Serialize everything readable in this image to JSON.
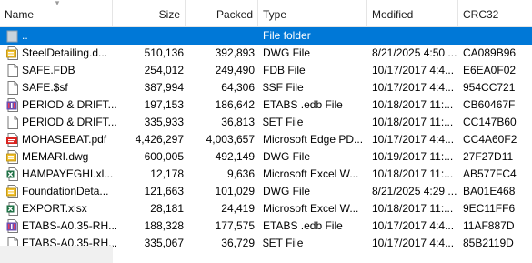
{
  "columns": {
    "name": "Name",
    "size": "Size",
    "packed": "Packed",
    "type": "Type",
    "modified": "Modified",
    "crc": "CRC32"
  },
  "sort_indicator": "▾",
  "rows": [
    {
      "name": "..",
      "size": "",
      "packed": "",
      "type": "File folder",
      "modified": "",
      "crc": "",
      "icon": "parent-folder-icon",
      "selected": true
    },
    {
      "name": "SteelDetailing.d...",
      "size": "510,136",
      "packed": "392,893",
      "type": "DWG File",
      "modified": "8/21/2025 4:50 ...",
      "crc": "CA089B96",
      "icon": "dwg-file-icon"
    },
    {
      "name": "SAFE.FDB",
      "size": "254,012",
      "packed": "249,490",
      "type": "FDB File",
      "modified": "10/17/2017 4:4...",
      "crc": "E6EA0F02",
      "icon": "generic-file-icon"
    },
    {
      "name": "SAFE.$sf",
      "size": "387,994",
      "packed": "64,306",
      "type": "$SF File",
      "modified": "10/17/2017 4:4...",
      "crc": "954CC721",
      "icon": "generic-file-icon"
    },
    {
      "name": "PERIOD & DRIFT...",
      "size": "197,153",
      "packed": "186,642",
      "type": "ETABS .edb File",
      "modified": "10/18/2017 11:...",
      "crc": "CB60467F",
      "icon": "etabs-file-icon"
    },
    {
      "name": "PERIOD & DRIFT...",
      "size": "335,933",
      "packed": "36,813",
      "type": "$ET File",
      "modified": "10/18/2017 11:...",
      "crc": "CC147B60",
      "icon": "generic-file-icon"
    },
    {
      "name": "MOHASEBAT.pdf",
      "size": "4,426,297",
      "packed": "4,003,657",
      "type": "Microsoft Edge PD...",
      "modified": "10/17/2017 4:4...",
      "crc": "CC4A60F2",
      "icon": "pdf-file-icon"
    },
    {
      "name": "MEMARI.dwg",
      "size": "600,005",
      "packed": "492,149",
      "type": "DWG File",
      "modified": "10/19/2017 11:...",
      "crc": "27F27D11",
      "icon": "dwg-file-icon"
    },
    {
      "name": "HAMPAYEGHI.xl...",
      "size": "12,178",
      "packed": "9,636",
      "type": "Microsoft Excel W...",
      "modified": "10/18/2017 11:...",
      "crc": "AB577FC4",
      "icon": "excel-file-icon"
    },
    {
      "name": "FoundationDeta...",
      "size": "121,663",
      "packed": "101,029",
      "type": "DWG File",
      "modified": "8/21/2025 4:29 ...",
      "crc": "BA01E468",
      "icon": "dwg-file-icon"
    },
    {
      "name": "EXPORT.xlsx",
      "size": "28,181",
      "packed": "24,419",
      "type": "Microsoft Excel W...",
      "modified": "10/18/2017 11:...",
      "crc": "9EC11FF6",
      "icon": "excel-file-icon"
    },
    {
      "name": "ETABS-A0.35-RH...",
      "size": "188,328",
      "packed": "177,575",
      "type": "ETABS .edb File",
      "modified": "10/17/2017 4:4...",
      "crc": "11AF887D",
      "icon": "etabs-file-icon"
    },
    {
      "name": "ETABS-A0.35-RH...",
      "size": "335,067",
      "packed": "36,729",
      "type": "$ET File",
      "modified": "10/17/2017 4:4...",
      "crc": "85B2119D",
      "icon": "generic-file-icon"
    }
  ]
}
